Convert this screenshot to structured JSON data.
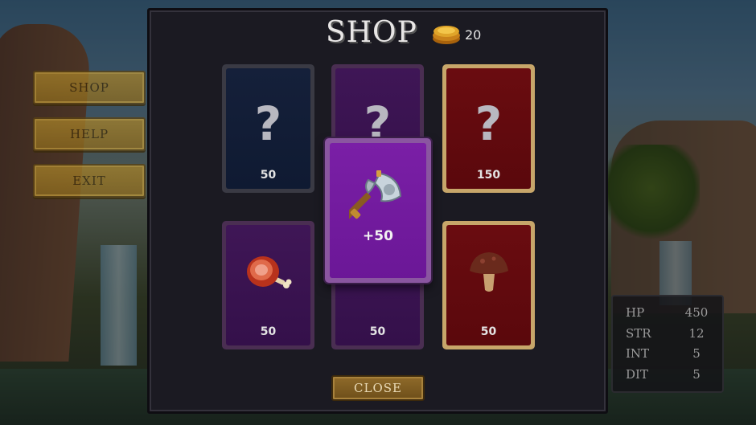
{
  "side_menu": {
    "shop_label": "SHOP",
    "help_label": "HELP",
    "exit_label": "EXIT"
  },
  "shop": {
    "title": "SHOP",
    "coins": "20",
    "featured_bonus": "+50",
    "close_label": "CLOSE",
    "cards": [
      {
        "slot": "top-1",
        "kind": "mystery",
        "color": "blue",
        "price": "50"
      },
      {
        "slot": "top-2",
        "kind": "mystery",
        "color": "purple",
        "price": ""
      },
      {
        "slot": "top-3",
        "kind": "mystery",
        "color": "red",
        "price": "150"
      },
      {
        "slot": "bottom-1",
        "kind": "meat",
        "color": "purple",
        "price": "50"
      },
      {
        "slot": "bottom-2",
        "kind": "hidden",
        "color": "purple",
        "price": "50"
      },
      {
        "slot": "bottom-3",
        "kind": "mushroom",
        "color": "red",
        "price": "50"
      }
    ],
    "mystery_glyph": "?"
  },
  "stats": [
    {
      "label": "HP",
      "value": "450"
    },
    {
      "label": "STR",
      "value": "12"
    },
    {
      "label": "INT",
      "value": "5"
    },
    {
      "label": "DIT",
      "value": "5"
    }
  ],
  "colors": {
    "card_blue": "#15203a",
    "card_purple": "#3f1656",
    "card_red": "#6a0c10",
    "featured_purple": "#7a1fa6",
    "gold_button": "#a8832a"
  }
}
